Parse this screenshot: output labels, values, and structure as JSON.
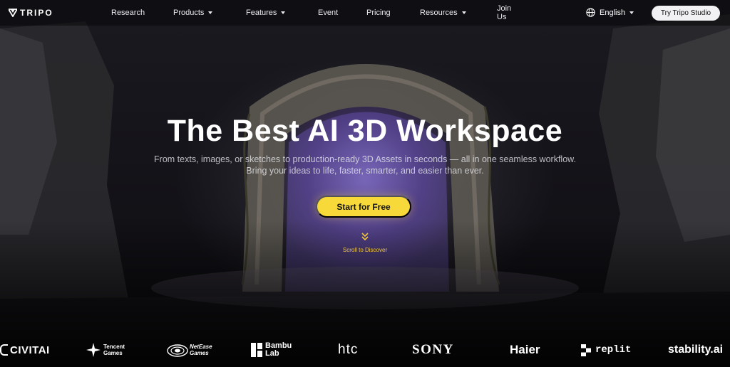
{
  "brand": {
    "name": "TRIPO"
  },
  "nav": {
    "items": [
      {
        "label": "Research",
        "caret": false
      },
      {
        "label": "Products",
        "caret": true
      },
      {
        "label": "Features",
        "caret": true
      },
      {
        "label": "Event",
        "caret": false
      },
      {
        "label": "Pricing",
        "caret": false
      },
      {
        "label": "Resources",
        "caret": true
      },
      {
        "label": "Join Us",
        "caret": false
      }
    ],
    "language": "English",
    "cta_label": "Try Tripo Studio"
  },
  "hero": {
    "title": "The Best AI 3D Workspace",
    "subtitle_line1": "From texts, images, or sketches to production-ready 3D Assets in seconds — all in one seamless workflow.",
    "subtitle_line2": "Bring your ideas to life, faster, smarter, and easier than ever.",
    "cta_label": "Start for Free",
    "scroll_label": "Scroll to Discover"
  },
  "partners": [
    {
      "name": "CIVITAI",
      "line2": ""
    },
    {
      "name": "Tencent",
      "line2": "Games"
    },
    {
      "name": "NetEase",
      "line2": "Games"
    },
    {
      "name": "Bambu",
      "line2": "Lab"
    },
    {
      "name": "htc",
      "line2": ""
    },
    {
      "name": "SONY",
      "line2": ""
    },
    {
      "name": "Haier",
      "line2": ""
    },
    {
      "name": "replit",
      "line2": ""
    },
    {
      "name": "stability.ai",
      "line2": ""
    }
  ],
  "colors": {
    "accent": "#f7d93a",
    "scroll": "#f2c73a",
    "nav_bg": "#08080a"
  }
}
